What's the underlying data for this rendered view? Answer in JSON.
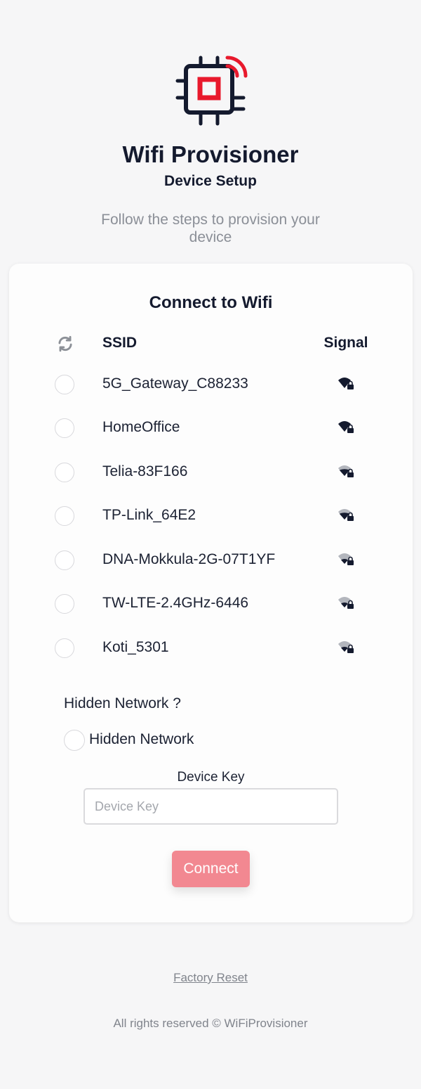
{
  "header": {
    "title": "Wifi Provisioner",
    "subtitle": "Device Setup",
    "instructions": "Follow the steps to provision your device"
  },
  "colors": {
    "accent": "#e8192c",
    "dark": "#141a2e",
    "button": "#f28891"
  },
  "card": {
    "title": "Connect to Wifi",
    "refresh_icon": "refresh-icon",
    "columns": {
      "ssid": "SSID",
      "signal": "Signal"
    },
    "networks": [
      {
        "ssid": "5G_Gateway_C88233",
        "signal": 4
      },
      {
        "ssid": "HomeOffice",
        "signal": 4
      },
      {
        "ssid": "Telia-83F166",
        "signal": 3
      },
      {
        "ssid": "TP-Link_64E2",
        "signal": 3
      },
      {
        "ssid": "DNA-Mokkula-2G-07T1YF",
        "signal": 2
      },
      {
        "ssid": "TW-LTE-2.4GHz-6446",
        "signal": 2
      },
      {
        "ssid": "Koti_5301",
        "signal": 2
      }
    ],
    "hidden_network": {
      "question": "Hidden Network ?",
      "option_label": "Hidden Network"
    },
    "device_key": {
      "label": "Device Key",
      "placeholder": "Device Key",
      "value": ""
    },
    "connect_label": "Connect"
  },
  "footer": {
    "factory_reset": "Factory Reset",
    "copyright": "All rights reserved © WiFiProvisioner"
  }
}
